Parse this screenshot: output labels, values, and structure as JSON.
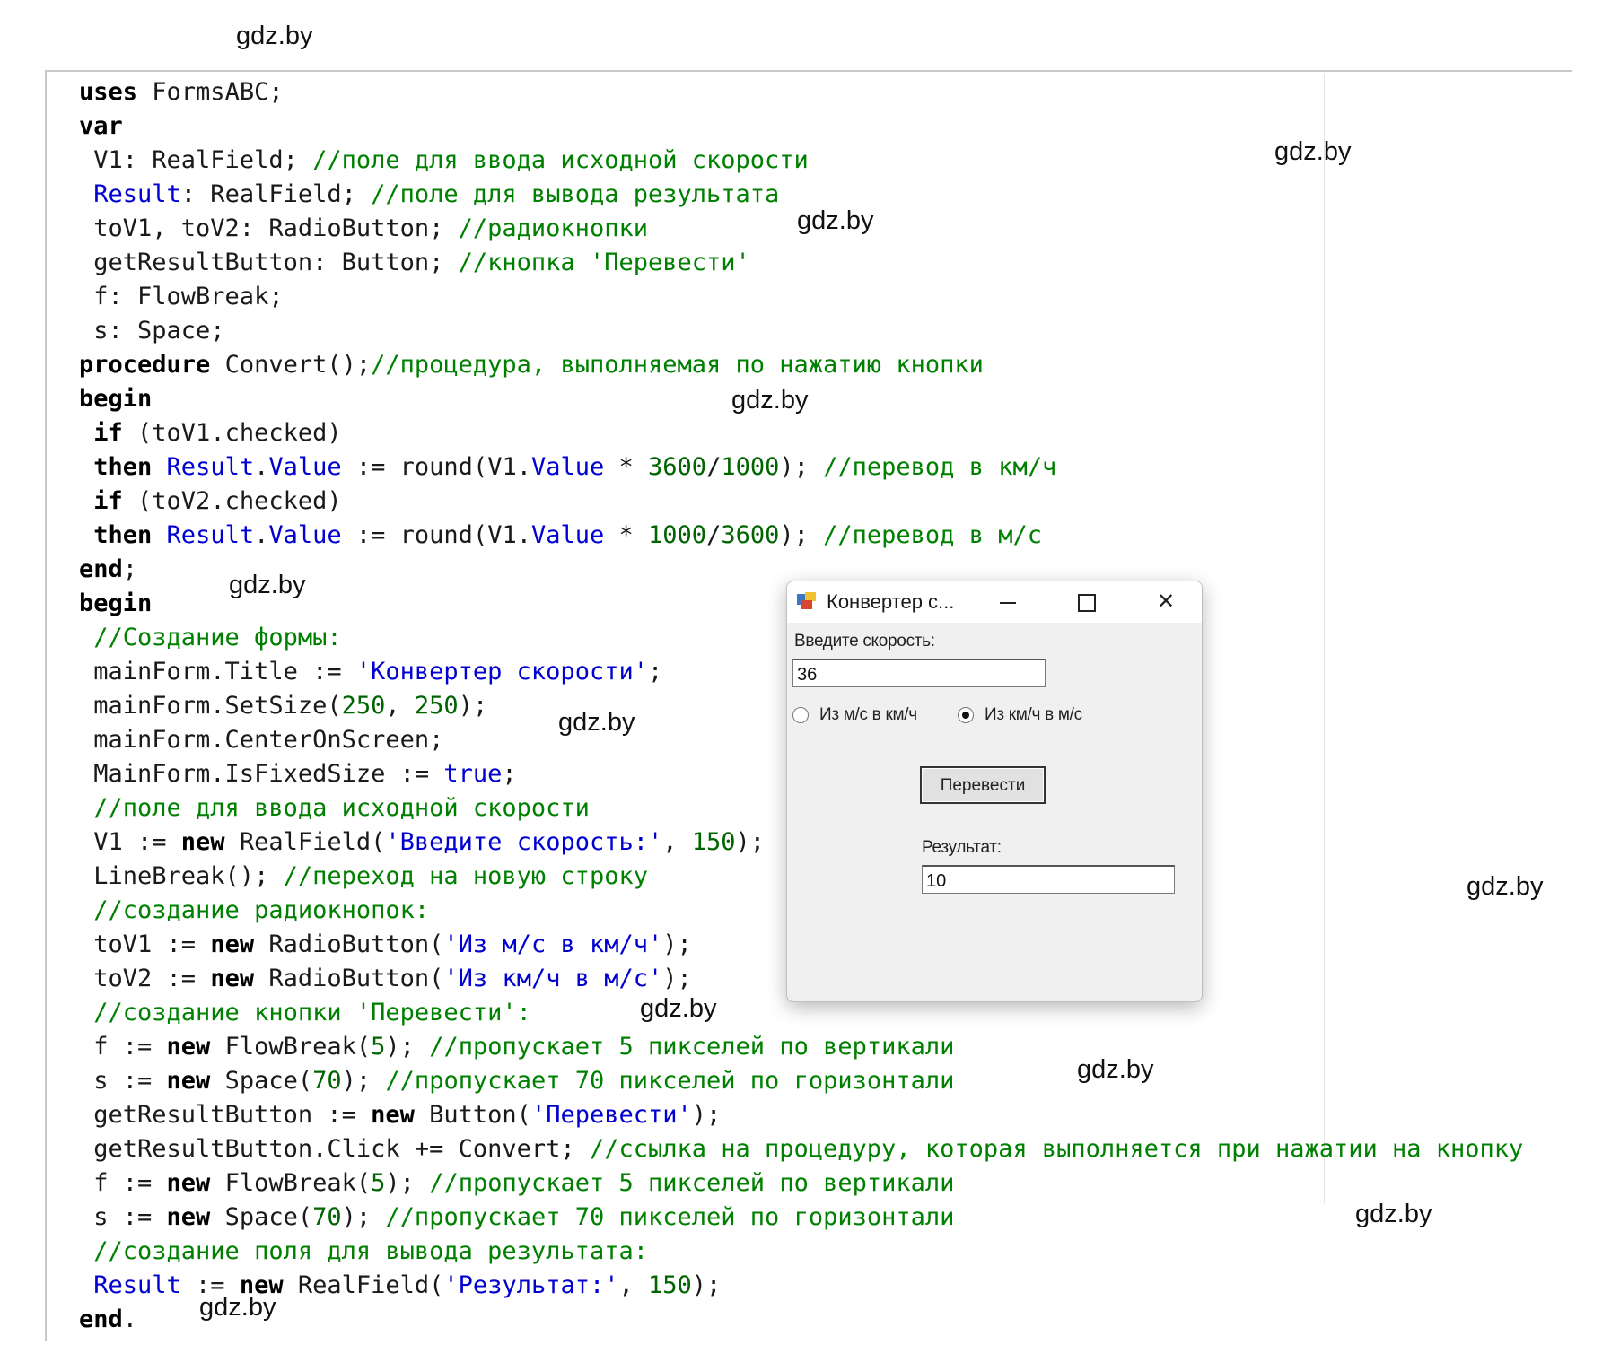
{
  "code_lines": [
    [
      [
        "kw",
        "uses"
      ],
      [
        "pl",
        " FormsABC;"
      ]
    ],
    [
      [
        "kw",
        "var"
      ]
    ],
    [
      [
        "pl",
        " V1: RealField; "
      ],
      [
        "cm",
        "//поле для ввода исходной скорости"
      ]
    ],
    [
      [
        "id",
        " Result"
      ],
      [
        "pl",
        ": RealField; "
      ],
      [
        "cm",
        "//поле для вывода результата"
      ]
    ],
    [
      [
        "pl",
        " toV1, toV2: RadioButton; "
      ],
      [
        "cm",
        "//радиокнопки"
      ]
    ],
    [
      [
        "pl",
        " getResultButton: Button; "
      ],
      [
        "cm",
        "//кнопка 'Перевести'"
      ]
    ],
    [
      [
        "pl",
        " f: FlowBreak;"
      ]
    ],
    [
      [
        "pl",
        " s: Space;"
      ]
    ],
    [
      [
        "kw",
        "procedure"
      ],
      [
        "pl",
        " Convert();"
      ],
      [
        "cm",
        "//процедура, выполняемая по нажатию кнопки"
      ]
    ],
    [
      [
        "kw",
        "begin"
      ]
    ],
    [
      [
        "pl",
        " "
      ],
      [
        "kw",
        "if"
      ],
      [
        "pl",
        " (toV1.checked)"
      ]
    ],
    [
      [
        "pl",
        " "
      ],
      [
        "kw",
        "then"
      ],
      [
        "id",
        " Result"
      ],
      [
        "pl",
        "."
      ],
      [
        "id",
        "Value"
      ],
      [
        "pl",
        " := round(V1."
      ],
      [
        "id",
        "Value"
      ],
      [
        "pl",
        " * "
      ],
      [
        "num",
        "3600"
      ],
      [
        "pl",
        "/"
      ],
      [
        "num",
        "1000"
      ],
      [
        "pl",
        "); "
      ],
      [
        "cm",
        "//перевод в км/ч"
      ]
    ],
    [
      [
        "pl",
        " "
      ],
      [
        "kw",
        "if"
      ],
      [
        "pl",
        " (toV2.checked)"
      ]
    ],
    [
      [
        "pl",
        " "
      ],
      [
        "kw",
        "then"
      ],
      [
        "id",
        " Result"
      ],
      [
        "pl",
        "."
      ],
      [
        "id",
        "Value"
      ],
      [
        "pl",
        " := round(V1."
      ],
      [
        "id",
        "Value"
      ],
      [
        "pl",
        " * "
      ],
      [
        "num",
        "1000"
      ],
      [
        "pl",
        "/"
      ],
      [
        "num",
        "3600"
      ],
      [
        "pl",
        "); "
      ],
      [
        "cm",
        "//перевод в м/с"
      ]
    ],
    [
      [
        "kw",
        "end"
      ],
      [
        "pl",
        ";"
      ]
    ],
    [
      [
        "kw",
        "begin"
      ]
    ],
    [
      [
        "cm",
        " //Создание формы:"
      ]
    ],
    [
      [
        "pl",
        " mainForm.Title := "
      ],
      [
        "str",
        "'Конвертер скорости'"
      ],
      [
        "pl",
        ";"
      ]
    ],
    [
      [
        "pl",
        " mainForm.SetSize("
      ],
      [
        "num",
        "250"
      ],
      [
        "pl",
        ", "
      ],
      [
        "num",
        "250"
      ],
      [
        "pl",
        ");"
      ]
    ],
    [
      [
        "pl",
        " mainForm.CenterOnScreen;"
      ]
    ],
    [
      [
        "pl",
        " MainForm.IsFixedSize := "
      ],
      [
        "id",
        "true"
      ],
      [
        "pl",
        ";"
      ]
    ],
    [
      [
        "cm",
        " //поле для ввода исходной скорости"
      ]
    ],
    [
      [
        "pl",
        " V1 := "
      ],
      [
        "kw",
        "new"
      ],
      [
        "pl",
        " RealField("
      ],
      [
        "str",
        "'Введите скорость:'"
      ],
      [
        "pl",
        ", "
      ],
      [
        "num",
        "150"
      ],
      [
        "pl",
        ");"
      ]
    ],
    [
      [
        "pl",
        " LineBreak(); "
      ],
      [
        "cm",
        "//переход на новую строку"
      ]
    ],
    [
      [
        "cm",
        " //создание радиокнопок:"
      ]
    ],
    [
      [
        "pl",
        " toV1 := "
      ],
      [
        "kw",
        "new"
      ],
      [
        "pl",
        " RadioButton("
      ],
      [
        "str",
        "'Из м/с в км/ч'"
      ],
      [
        "pl",
        ");"
      ]
    ],
    [
      [
        "pl",
        " toV2 := "
      ],
      [
        "kw",
        "new"
      ],
      [
        "pl",
        " RadioButton("
      ],
      [
        "str",
        "'Из км/ч в м/с'"
      ],
      [
        "pl",
        ");"
      ]
    ],
    [
      [
        "cm",
        " //создание кнопки 'Перевести':"
      ]
    ],
    [
      [
        "pl",
        " f := "
      ],
      [
        "kw",
        "new"
      ],
      [
        "pl",
        " FlowBreak("
      ],
      [
        "num",
        "5"
      ],
      [
        "pl",
        "); "
      ],
      [
        "cm",
        "//пропускает 5 пикселей по вертикали"
      ]
    ],
    [
      [
        "pl",
        " s := "
      ],
      [
        "kw",
        "new"
      ],
      [
        "pl",
        " Space("
      ],
      [
        "num",
        "70"
      ],
      [
        "pl",
        "); "
      ],
      [
        "cm",
        "//пропускает 70 пикселей по горизонтали"
      ]
    ],
    [
      [
        "pl",
        " getResultButton := "
      ],
      [
        "kw",
        "new"
      ],
      [
        "pl",
        " Button("
      ],
      [
        "str",
        "'Перевести'"
      ],
      [
        "pl",
        ");"
      ]
    ],
    [
      [
        "pl",
        " getResultButton.Click += Convert; "
      ],
      [
        "cm",
        "//ссылка на процедуру, которая выполняется при нажатии на кнопку"
      ]
    ],
    [
      [
        "pl",
        " f := "
      ],
      [
        "kw",
        "new"
      ],
      [
        "pl",
        " FlowBreak("
      ],
      [
        "num",
        "5"
      ],
      [
        "pl",
        "); "
      ],
      [
        "cm",
        "//пропускает 5 пикселей по вертикали"
      ]
    ],
    [
      [
        "pl",
        " s := "
      ],
      [
        "kw",
        "new"
      ],
      [
        "pl",
        " Space("
      ],
      [
        "num",
        "70"
      ],
      [
        "pl",
        "); "
      ],
      [
        "cm",
        "//пропускает 70 пикселей по горизонтали"
      ]
    ],
    [
      [
        "cm",
        " //создание поля для вывода результата:"
      ]
    ],
    [
      [
        "id",
        " Result"
      ],
      [
        "pl",
        " := "
      ],
      [
        "kw",
        "new"
      ],
      [
        "pl",
        " RealField("
      ],
      [
        "str",
        "'Результат:'"
      ],
      [
        "pl",
        ", "
      ],
      [
        "num",
        "150"
      ],
      [
        "pl",
        ");"
      ]
    ],
    [
      [
        "kw",
        "end"
      ],
      [
        "pl",
        "."
      ]
    ]
  ],
  "watermark": "gdz.by",
  "form": {
    "title": "Конвертер с...",
    "input_label": "Введите скорость:",
    "input_value": "36",
    "radio1_label": "Из м/с в км/ч",
    "radio1_checked": false,
    "radio2_label": "Из км/ч в м/с",
    "radio2_checked": true,
    "button_label": "Перевести",
    "result_label": "Результат:",
    "result_value": "10"
  },
  "colors": {
    "keyword": "#000000",
    "identifier": "#0000d0",
    "string": "#0000d0",
    "number": "#006400",
    "comment": "#008000"
  },
  "icons": [
    "app-icon",
    "minimize-icon",
    "maximize-icon",
    "close-icon"
  ]
}
